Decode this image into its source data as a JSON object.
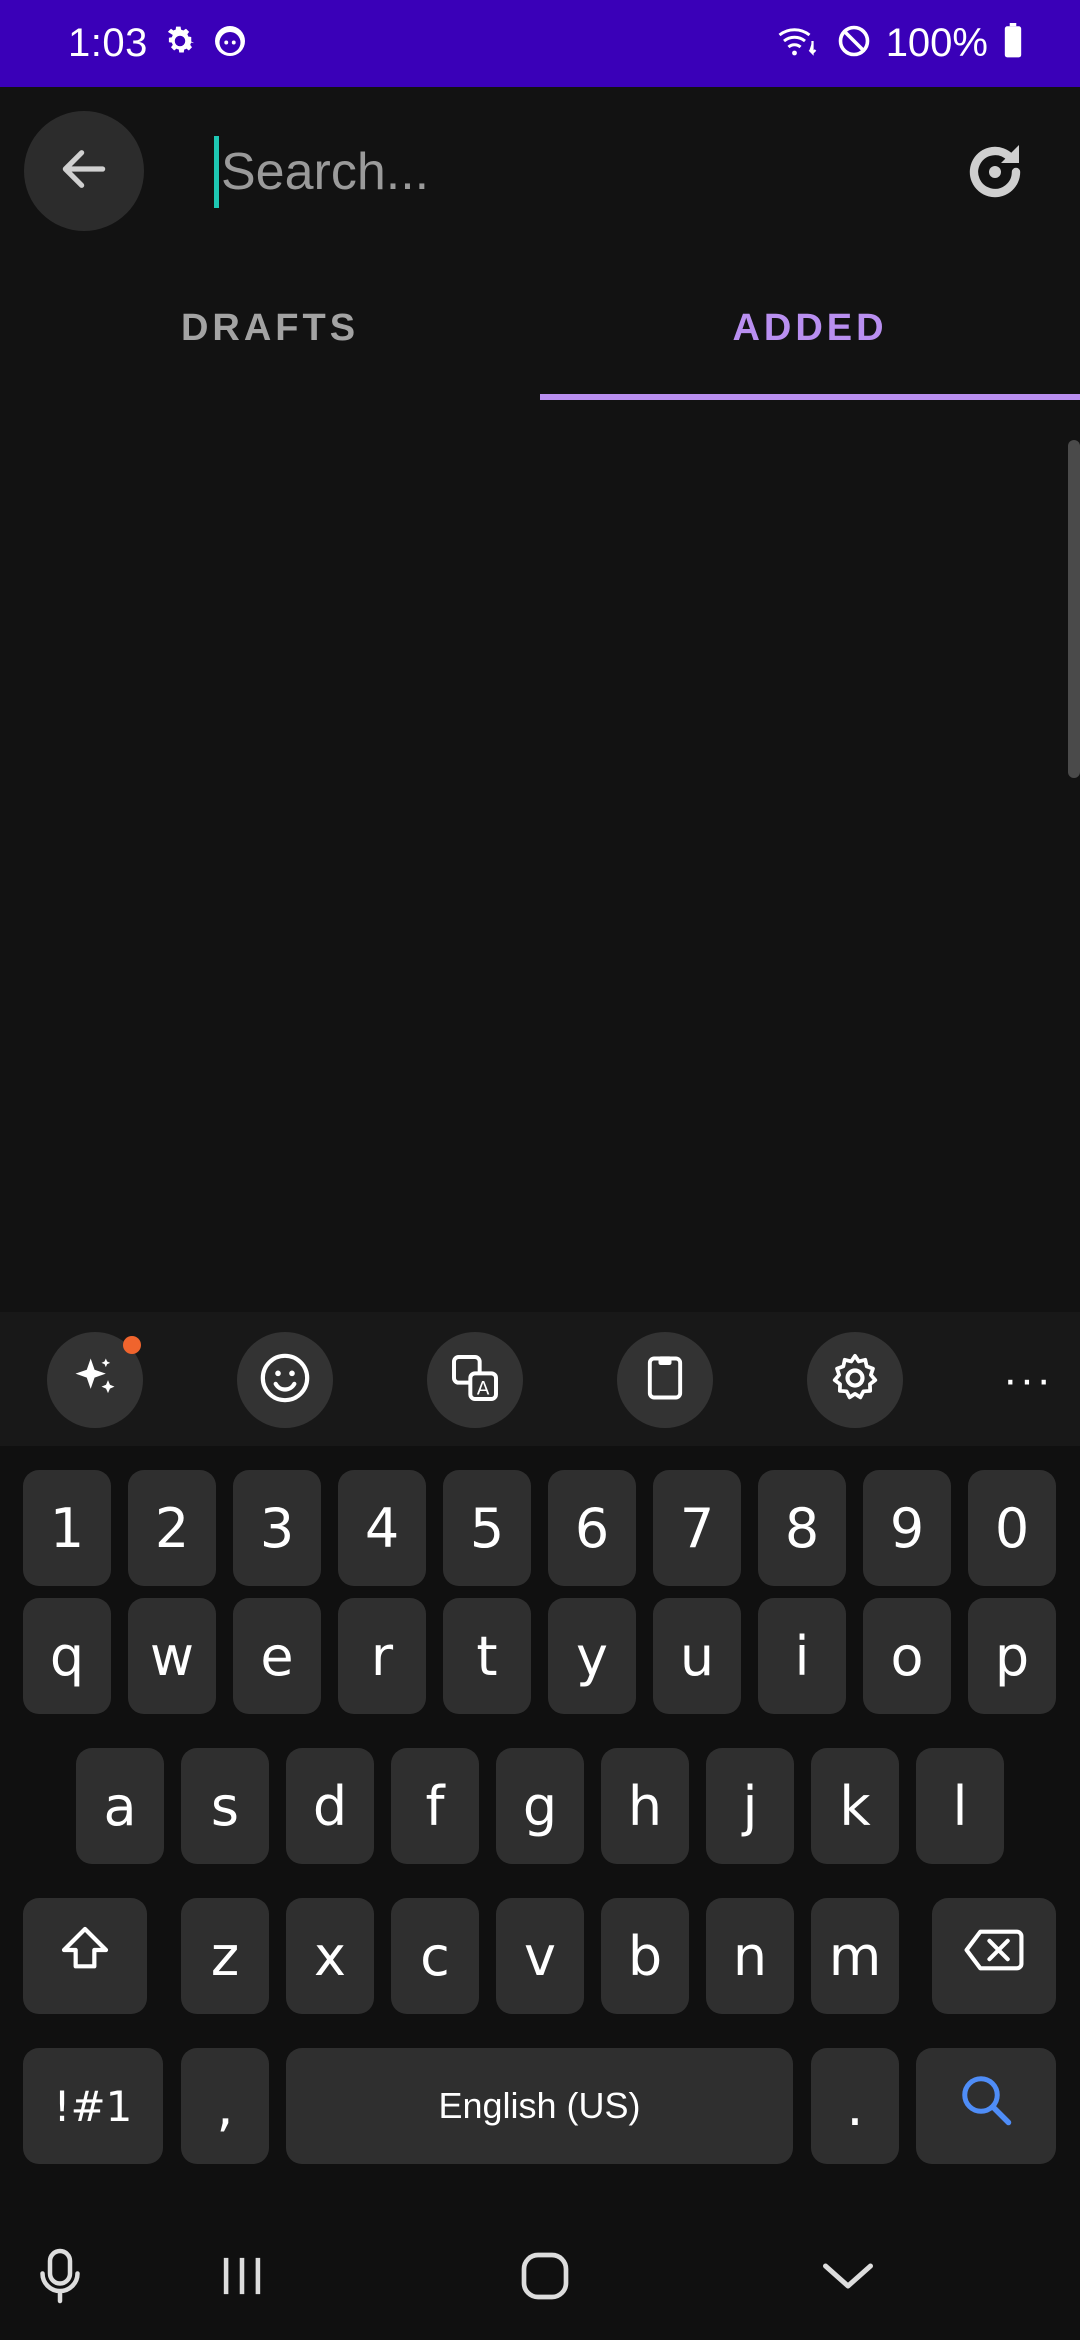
{
  "status_bar": {
    "time": "1:03",
    "battery_text": "100%",
    "background_color": "#3a00b8",
    "icons": [
      "gear-icon",
      "face-notification-icon",
      "wifi-call-icon",
      "do-not-disturb-icon",
      "battery-icon"
    ]
  },
  "app_bar": {
    "search_placeholder": "Search...",
    "search_value": "",
    "back_icon": "arrow-left-icon",
    "refresh_icon": "refresh-icon"
  },
  "tabs": [
    {
      "label": "DRAFTS",
      "active": false
    },
    {
      "label": "ADDED",
      "active": true
    }
  ],
  "accent_color": "#b98ff0",
  "keyboard_toolbar": {
    "items": [
      "ai-sparkle-icon",
      "emoji-icon",
      "translate-icon",
      "clipboard-icon",
      "settings-icon",
      "more-icon"
    ],
    "more_label": "···",
    "notification_dot_color": "#f0642d"
  },
  "keyboard": {
    "number_row": [
      "1",
      "2",
      "3",
      "4",
      "5",
      "6",
      "7",
      "8",
      "9",
      "0"
    ],
    "row1": [
      "q",
      "w",
      "e",
      "r",
      "t",
      "y",
      "u",
      "i",
      "o",
      "p"
    ],
    "row2": [
      "a",
      "s",
      "d",
      "f",
      "g",
      "h",
      "j",
      "k",
      "l"
    ],
    "row3": [
      "z",
      "x",
      "c",
      "v",
      "b",
      "n",
      "m"
    ],
    "symbols_label": "!#1",
    "comma_label": ",",
    "space_label": "English (US)",
    "period_label": "."
  },
  "nav_bar": {
    "items": [
      "microphone-icon",
      "recents-icon",
      "home-icon",
      "hide-keyboard-icon"
    ]
  }
}
